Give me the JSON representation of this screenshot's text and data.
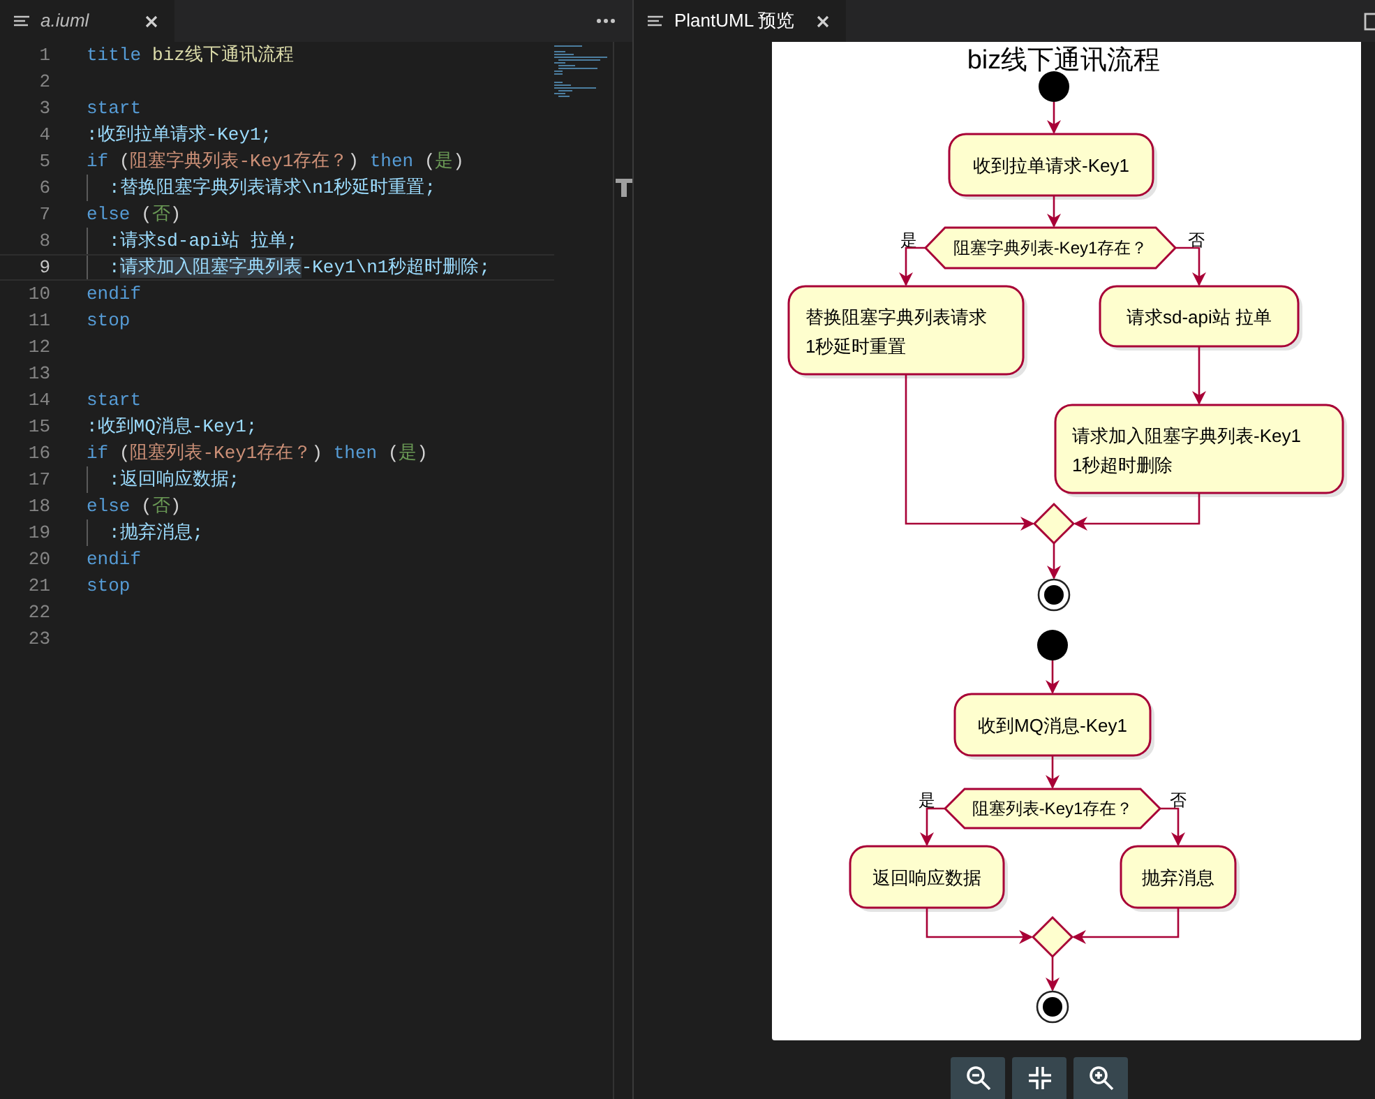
{
  "editor": {
    "tab": {
      "title": "a.iuml",
      "preview": true,
      "selected": true
    },
    "lines": [
      {
        "number": "1",
        "tokens": [
          {
            "kind": "keyword",
            "text": "title"
          },
          {
            "kind": "title",
            "text": "biz线下通讯流程",
            "gap": true
          }
        ]
      },
      {
        "number": "2"
      },
      {
        "number": "3",
        "tokens": [
          {
            "kind": "keyword",
            "text": "start"
          }
        ]
      },
      {
        "number": "4",
        "tokens": [
          {
            "kind": "label",
            "text": ":收到拉单请求-Key1;"
          }
        ]
      },
      {
        "number": "5",
        "tokens": [
          {
            "kind": "keyword",
            "text": "if"
          },
          {
            "kind": "plain",
            "text": " ("
          },
          {
            "kind": "string",
            "text": "阻塞字典列表-Key1存在？"
          },
          {
            "kind": "plain",
            "text": ") "
          },
          {
            "kind": "keyword",
            "text": "then"
          },
          {
            "kind": "plain",
            "text": " ("
          },
          {
            "kind": "branch",
            "text": "是"
          },
          {
            "kind": "plain",
            "text": ")"
          }
        ]
      },
      {
        "number": "6",
        "guide": true,
        "tokens": [
          {
            "kind": "label",
            "text": ":替换阻塞字典列表请求\\n1秒延时重置;"
          }
        ]
      },
      {
        "number": "7",
        "tokens": [
          {
            "kind": "keyword",
            "text": "else"
          },
          {
            "kind": "plain",
            "text": " ("
          },
          {
            "kind": "branch",
            "text": "否"
          },
          {
            "kind": "plain",
            "text": ")"
          }
        ]
      },
      {
        "number": "8",
        "guide": true,
        "tokens": [
          {
            "kind": "label",
            "text": ":请求sd-api站 拉单;"
          }
        ]
      },
      {
        "number": "9",
        "guide": true,
        "current": true,
        "tokens": [
          {
            "kind": "label",
            "text": ":"
          },
          {
            "kind": "match",
            "text": "请求加入阻塞字典列表"
          },
          {
            "kind": "label",
            "text": "-Key1\\n1秒超时删除;"
          }
        ]
      },
      {
        "number": "10",
        "tokens": [
          {
            "kind": "keyword",
            "text": "endif"
          }
        ]
      },
      {
        "number": "11",
        "tokens": [
          {
            "kind": "keyword",
            "text": "stop"
          }
        ]
      },
      {
        "number": "12"
      },
      {
        "number": "13"
      },
      {
        "number": "14",
        "tokens": [
          {
            "kind": "keyword",
            "text": "start"
          }
        ]
      },
      {
        "number": "15",
        "tokens": [
          {
            "kind": "label",
            "text": ":收到MQ消息-Key1;"
          }
        ]
      },
      {
        "number": "16",
        "tokens": [
          {
            "kind": "keyword",
            "text": "if"
          },
          {
            "kind": "plain",
            "text": " ("
          },
          {
            "kind": "string",
            "text": "阻塞列表-Key1存在？"
          },
          {
            "kind": "plain",
            "text": ") "
          },
          {
            "kind": "keyword",
            "text": "then"
          },
          {
            "kind": "plain",
            "text": " ("
          },
          {
            "kind": "branch",
            "text": "是"
          },
          {
            "kind": "plain",
            "text": ")"
          }
        ]
      },
      {
        "number": "17",
        "guide": true,
        "tokens": [
          {
            "kind": "label",
            "text": ":返回响应数据;"
          }
        ]
      },
      {
        "number": "18",
        "tokens": [
          {
            "kind": "keyword",
            "text": "else"
          },
          {
            "kind": "plain",
            "text": " ("
          },
          {
            "kind": "branch",
            "text": "否"
          },
          {
            "kind": "plain",
            "text": ")"
          }
        ]
      },
      {
        "number": "19",
        "guide": true,
        "tokens": [
          {
            "kind": "label",
            "text": ":抛弃消息;"
          }
        ]
      },
      {
        "number": "20",
        "tokens": [
          {
            "kind": "keyword",
            "text": "endif"
          }
        ]
      },
      {
        "number": "21",
        "tokens": [
          {
            "kind": "keyword",
            "text": "stop"
          }
        ]
      },
      {
        "number": "22"
      },
      {
        "number": "23"
      }
    ]
  },
  "preview": {
    "tab": {
      "title": "PlantUML 预览",
      "preview": false,
      "selected": true
    },
    "diagram": {
      "title": "biz线下通讯流程",
      "flows": [
        {
          "action": [
            "收到拉单请求-Key1"
          ],
          "condition": "阻塞字典列表-Key1存在？",
          "yes_label": "是",
          "no_label": "否",
          "yes": [
            [
              "替换阻塞字典列表请求",
              "1秒延时重置"
            ]
          ],
          "no": [
            [
              "请求sd-api站 拉单"
            ],
            [
              "请求加入阻塞字典列表-Key1",
              "1秒超时删除"
            ]
          ]
        },
        {
          "action": [
            "收到MQ消息-Key1"
          ],
          "condition": "阻塞列表-Key1存在？",
          "yes_label": "是",
          "no_label": "否",
          "yes": [
            [
              "返回响应数据"
            ]
          ],
          "no": [
            [
              "抛弃消息"
            ]
          ]
        }
      ]
    },
    "toolbar": [
      {
        "kind": "zoom-out"
      },
      {
        "kind": "fit"
      },
      {
        "kind": "zoom-in"
      }
    ]
  }
}
